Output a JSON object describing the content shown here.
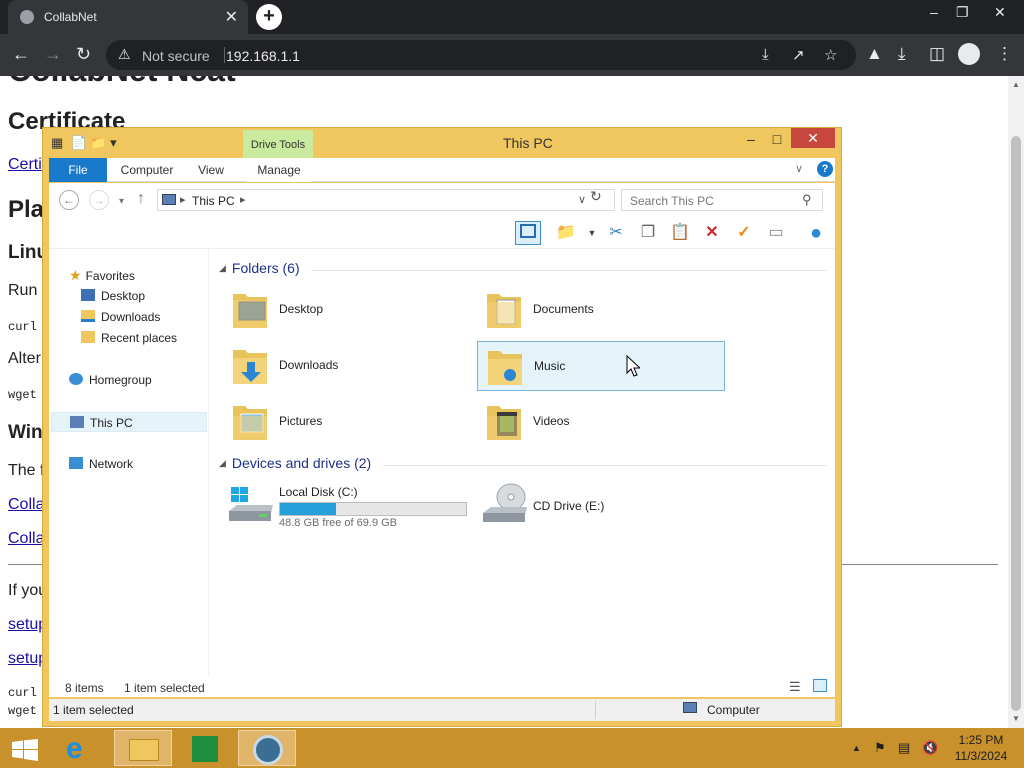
{
  "browser": {
    "tab_title": "CollabNet",
    "tab_close": "✕",
    "new_tab": "+",
    "security_label": "Not secure",
    "url": "192.168.1.1",
    "window_controls": [
      "–",
      "❐",
      "✕"
    ]
  },
  "webpage": {
    "heading_top": "CollabNet Ncat",
    "certificate_heading": "Certificate",
    "cert_link": "Certi",
    "platform_heading": "Pla",
    "linux_heading": "Linu",
    "run_text": "Run",
    "curl_cmd": "curl",
    "alter_text": "Alter",
    "wget_cmd": "wget",
    "windows_heading": "Win",
    "the_text": "The f",
    "colla_link_1": "Colla",
    "colla_link_2": "Colla",
    "if_you_text": "If you",
    "setup_link_1": "setup",
    "setup_link_2": "setup",
    "curl_cmd_2": "curl",
    "wget_cmd_2": "wget"
  },
  "explorer": {
    "title": "This PC",
    "drive_tools_label": "Drive Tools",
    "tabs": [
      {
        "label": "File"
      },
      {
        "label": "Computer"
      },
      {
        "label": "View"
      },
      {
        "label": "Manage"
      }
    ],
    "help": "?",
    "address": {
      "crumb": "This PC"
    },
    "search_placeholder": "Search This PC",
    "nav_pane": {
      "favorites": "Favorites",
      "desktop": "Desktop",
      "downloads": "Downloads",
      "recent": "Recent places",
      "homegroup": "Homegroup",
      "this_pc": "This PC",
      "network": "Network"
    },
    "folders_header": "Folders (6)",
    "folders": [
      {
        "label": "Desktop"
      },
      {
        "label": "Documents"
      },
      {
        "label": "Downloads"
      },
      {
        "label": "Music"
      },
      {
        "label": "Pictures"
      },
      {
        "label": "Videos"
      }
    ],
    "devices_header": "Devices and drives (2)",
    "drives": [
      {
        "label": "Local Disk (C:)",
        "free_text": "48.8 GB free of 69.9 GB",
        "used_fraction": 0.302
      },
      {
        "label": "CD Drive (E:)"
      }
    ],
    "status": {
      "items": "8 items",
      "selected": "1 item selected",
      "bottom_selected": "1 item selected",
      "computer": "Computer"
    }
  },
  "taskbar": {
    "clock_time": "1:25 PM",
    "clock_date": "11/3/2024"
  },
  "colors": {
    "explorer_frame": "#f0c75e",
    "taskbar": "#c8912c",
    "file_tab": "#1979ca",
    "drive_fill": "#26a0da"
  }
}
